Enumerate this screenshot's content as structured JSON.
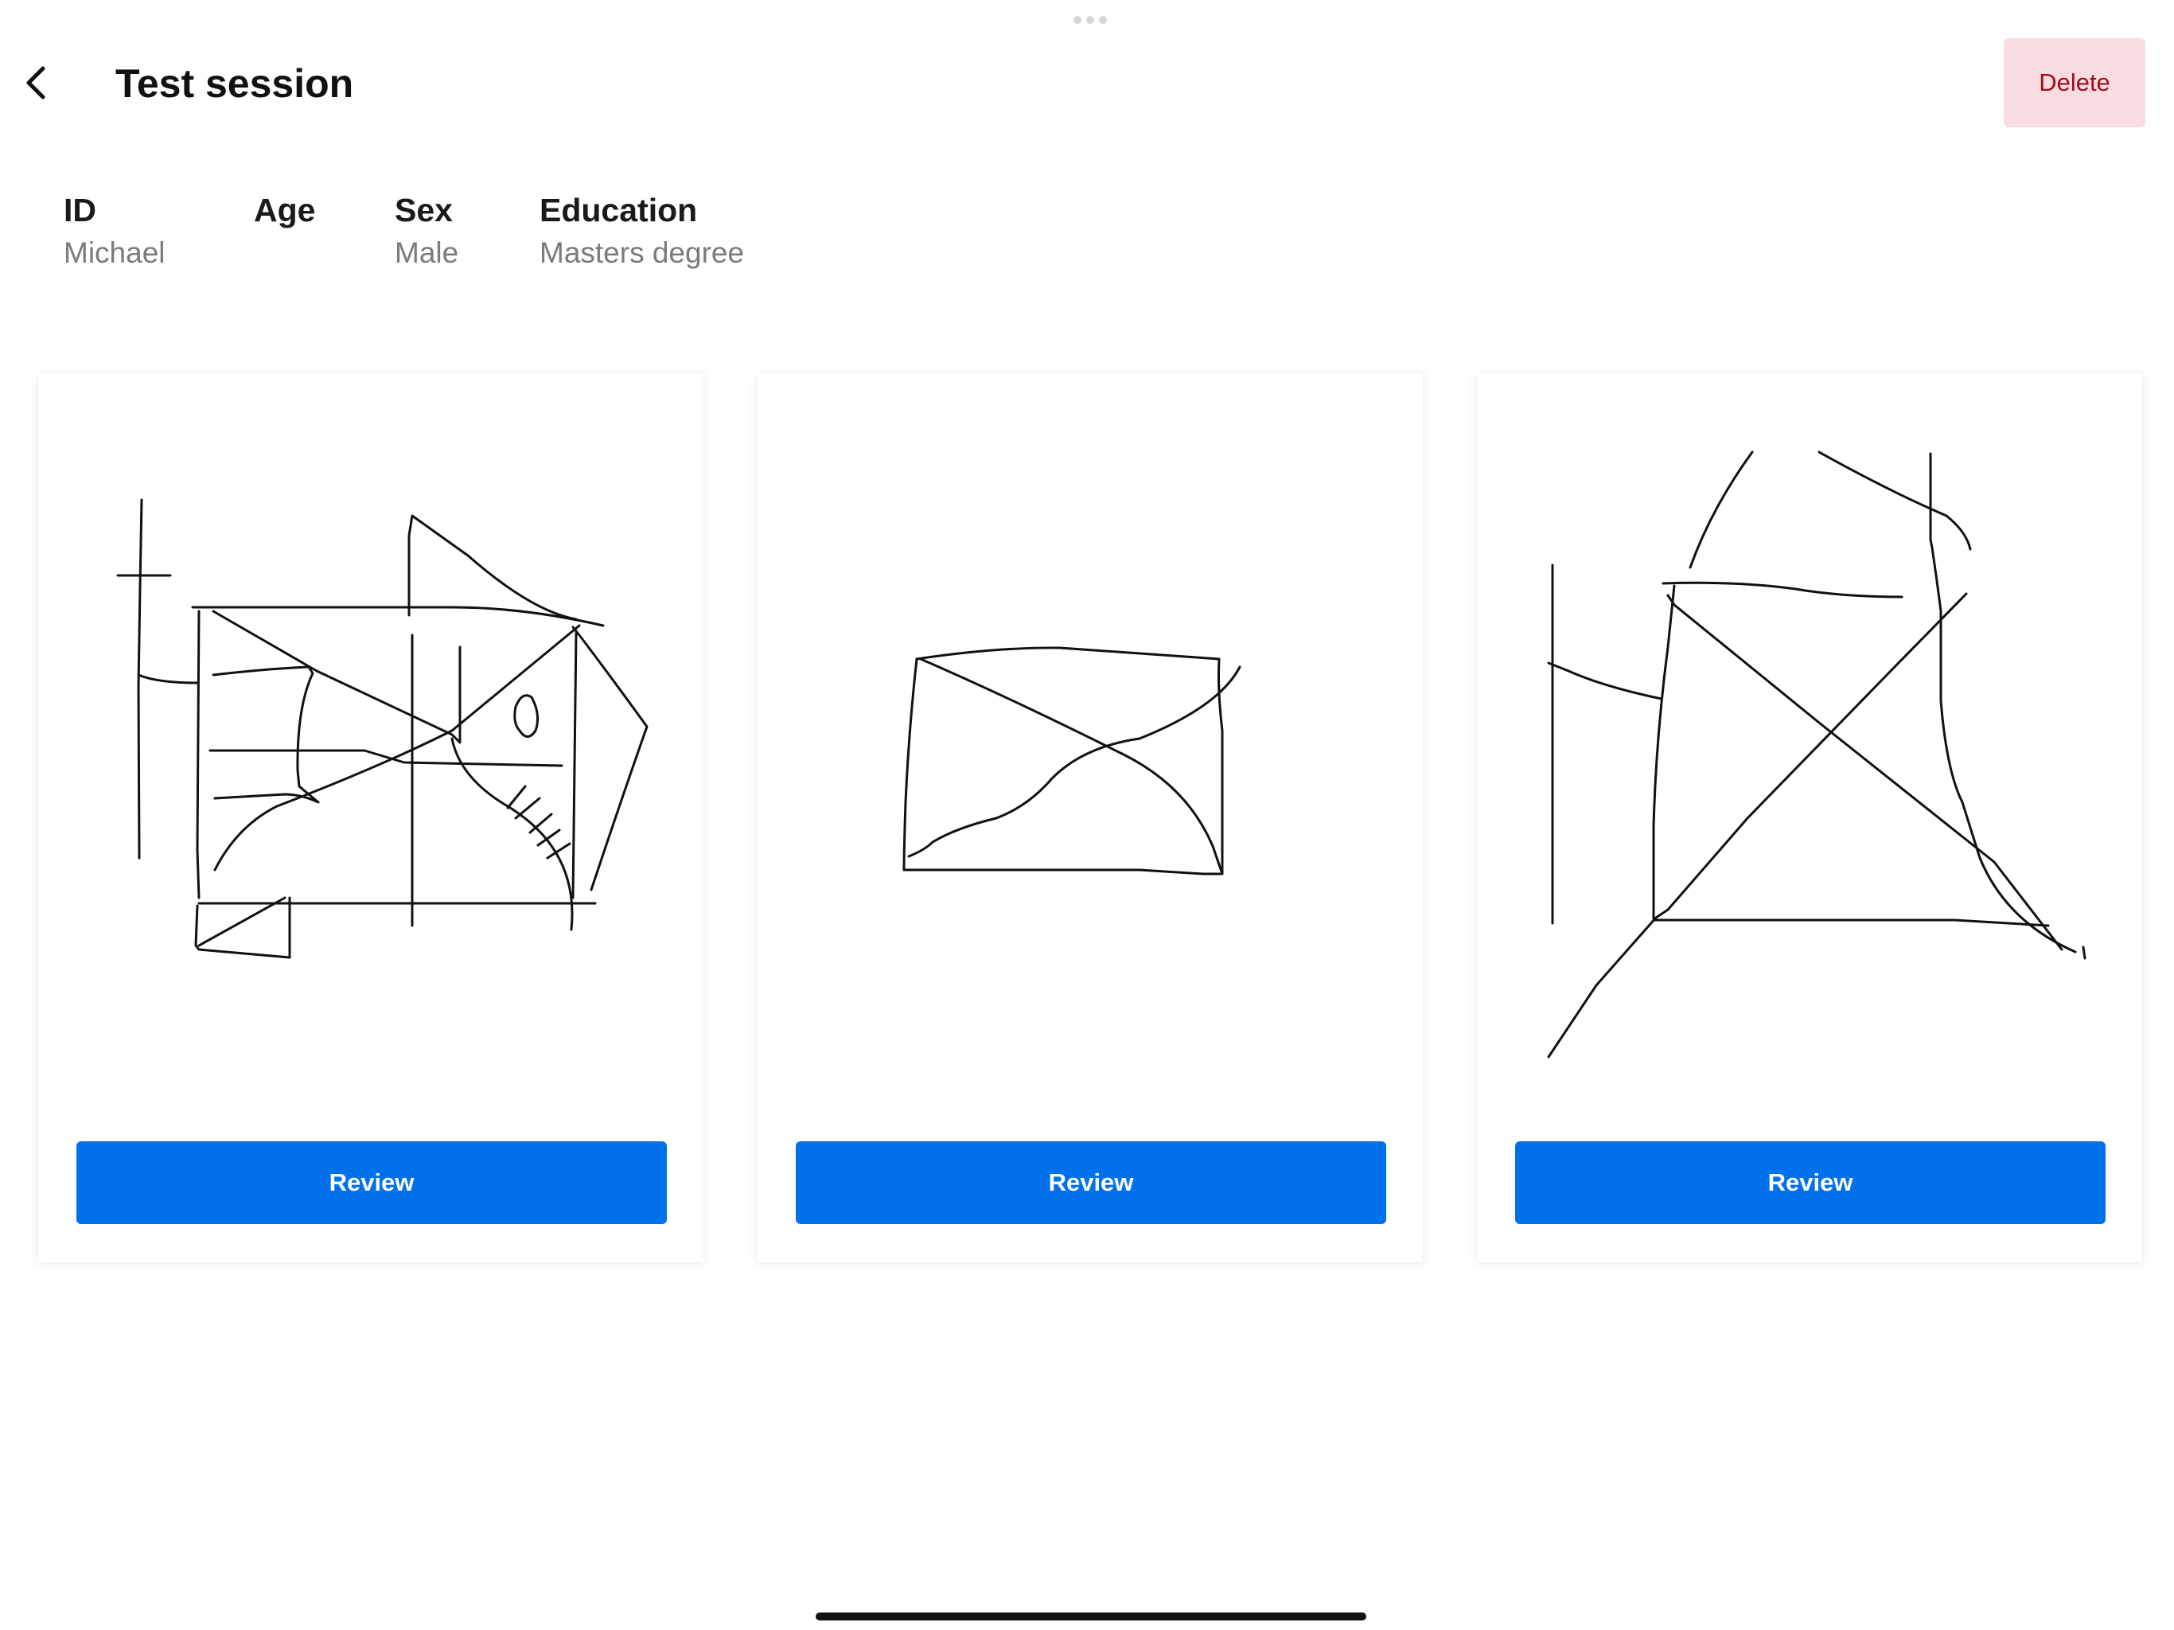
{
  "header": {
    "title": "Test session",
    "delete_label": "Delete"
  },
  "info": {
    "id_label": "ID",
    "id_value": "Michael",
    "age_label": "Age",
    "age_value": "",
    "sex_label": "Sex",
    "sex_value": "Male",
    "education_label": "Education",
    "education_value": "Masters degree"
  },
  "drawings": [
    {
      "review_label": "Review"
    },
    {
      "review_label": "Review"
    },
    {
      "review_label": "Review"
    }
  ],
  "colors": {
    "accent": "#0071ea",
    "delete_bg": "#f8dde0",
    "delete_text": "#a40d1f",
    "secondary_text": "#7b7b7b"
  },
  "icons": {
    "back": "chevron-left-icon",
    "grabber": "grabber-dots-icon"
  }
}
